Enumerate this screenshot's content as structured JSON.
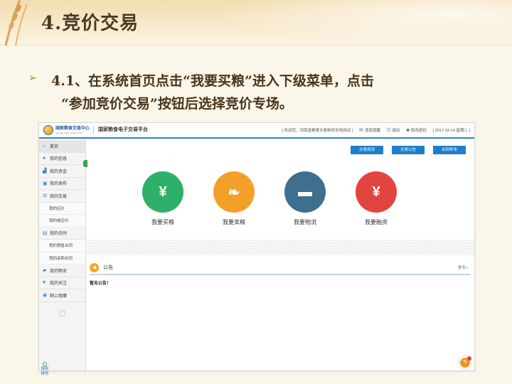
{
  "slide": {
    "title": "4.竞价交易",
    "bullet_line1": "4.1、在系统首页点击“我要买粮”进入下级菜单，点击",
    "bullet_line2": "“参加竞价交易”按钮后选择竞价专场。"
  },
  "app": {
    "logo": {
      "cn": "国家粮食交易中心",
      "en": "National Grain Trade Center"
    },
    "platform_name": "国家粮食电子交易平台",
    "top_right": {
      "welcome": "[ 欢迎您，河南省粮食交易物流市场测试 ]",
      "messages": "消息提醒",
      "logout": "退出",
      "change_password": "修改密码",
      "date": "[ 2017-03-14 星期二 ]"
    },
    "sidebar": {
      "items": [
        {
          "label": "首页",
          "icon": "home-icon",
          "active": true
        },
        {
          "label": "我的信息",
          "icon": "user-icon"
        },
        {
          "label": "我的资金",
          "icon": "chart-icon"
        },
        {
          "label": "我的发布",
          "icon": "publish-icon"
        },
        {
          "label": "我的交易",
          "icon": "trade-icon"
        }
      ],
      "trade_subs": [
        "我的应价",
        "我的被应价"
      ],
      "contract": {
        "label": "我的合同",
        "icon": "contract-icon"
      },
      "contract_subs": [
        "我的销售合同",
        "我的采购合同"
      ],
      "tail_items": [
        {
          "label": "我的物流",
          "icon": "logistics-icon"
        },
        {
          "label": "我的关注",
          "icon": "heart-icon"
        },
        {
          "label": "网上观摩",
          "icon": "eye-icon"
        }
      ],
      "search_label": "搜索推荐"
    },
    "buttons": [
      "交易规则",
      "交易公告",
      "合同样本"
    ],
    "tiles": [
      {
        "label": "我要买粮",
        "color": "#2eb06a",
        "glyph": "¥"
      },
      {
        "label": "我要卖粮",
        "color": "#f3a02a",
        "glyph": "❧"
      },
      {
        "label": "我要物流",
        "color": "#3f6f8f",
        "glyph": "▬"
      },
      {
        "label": "我要融资",
        "color": "#e2453f",
        "glyph": "¥"
      }
    ],
    "notice": {
      "title": "公告",
      "more": "更多»",
      "empty": "暂无公告！"
    }
  }
}
